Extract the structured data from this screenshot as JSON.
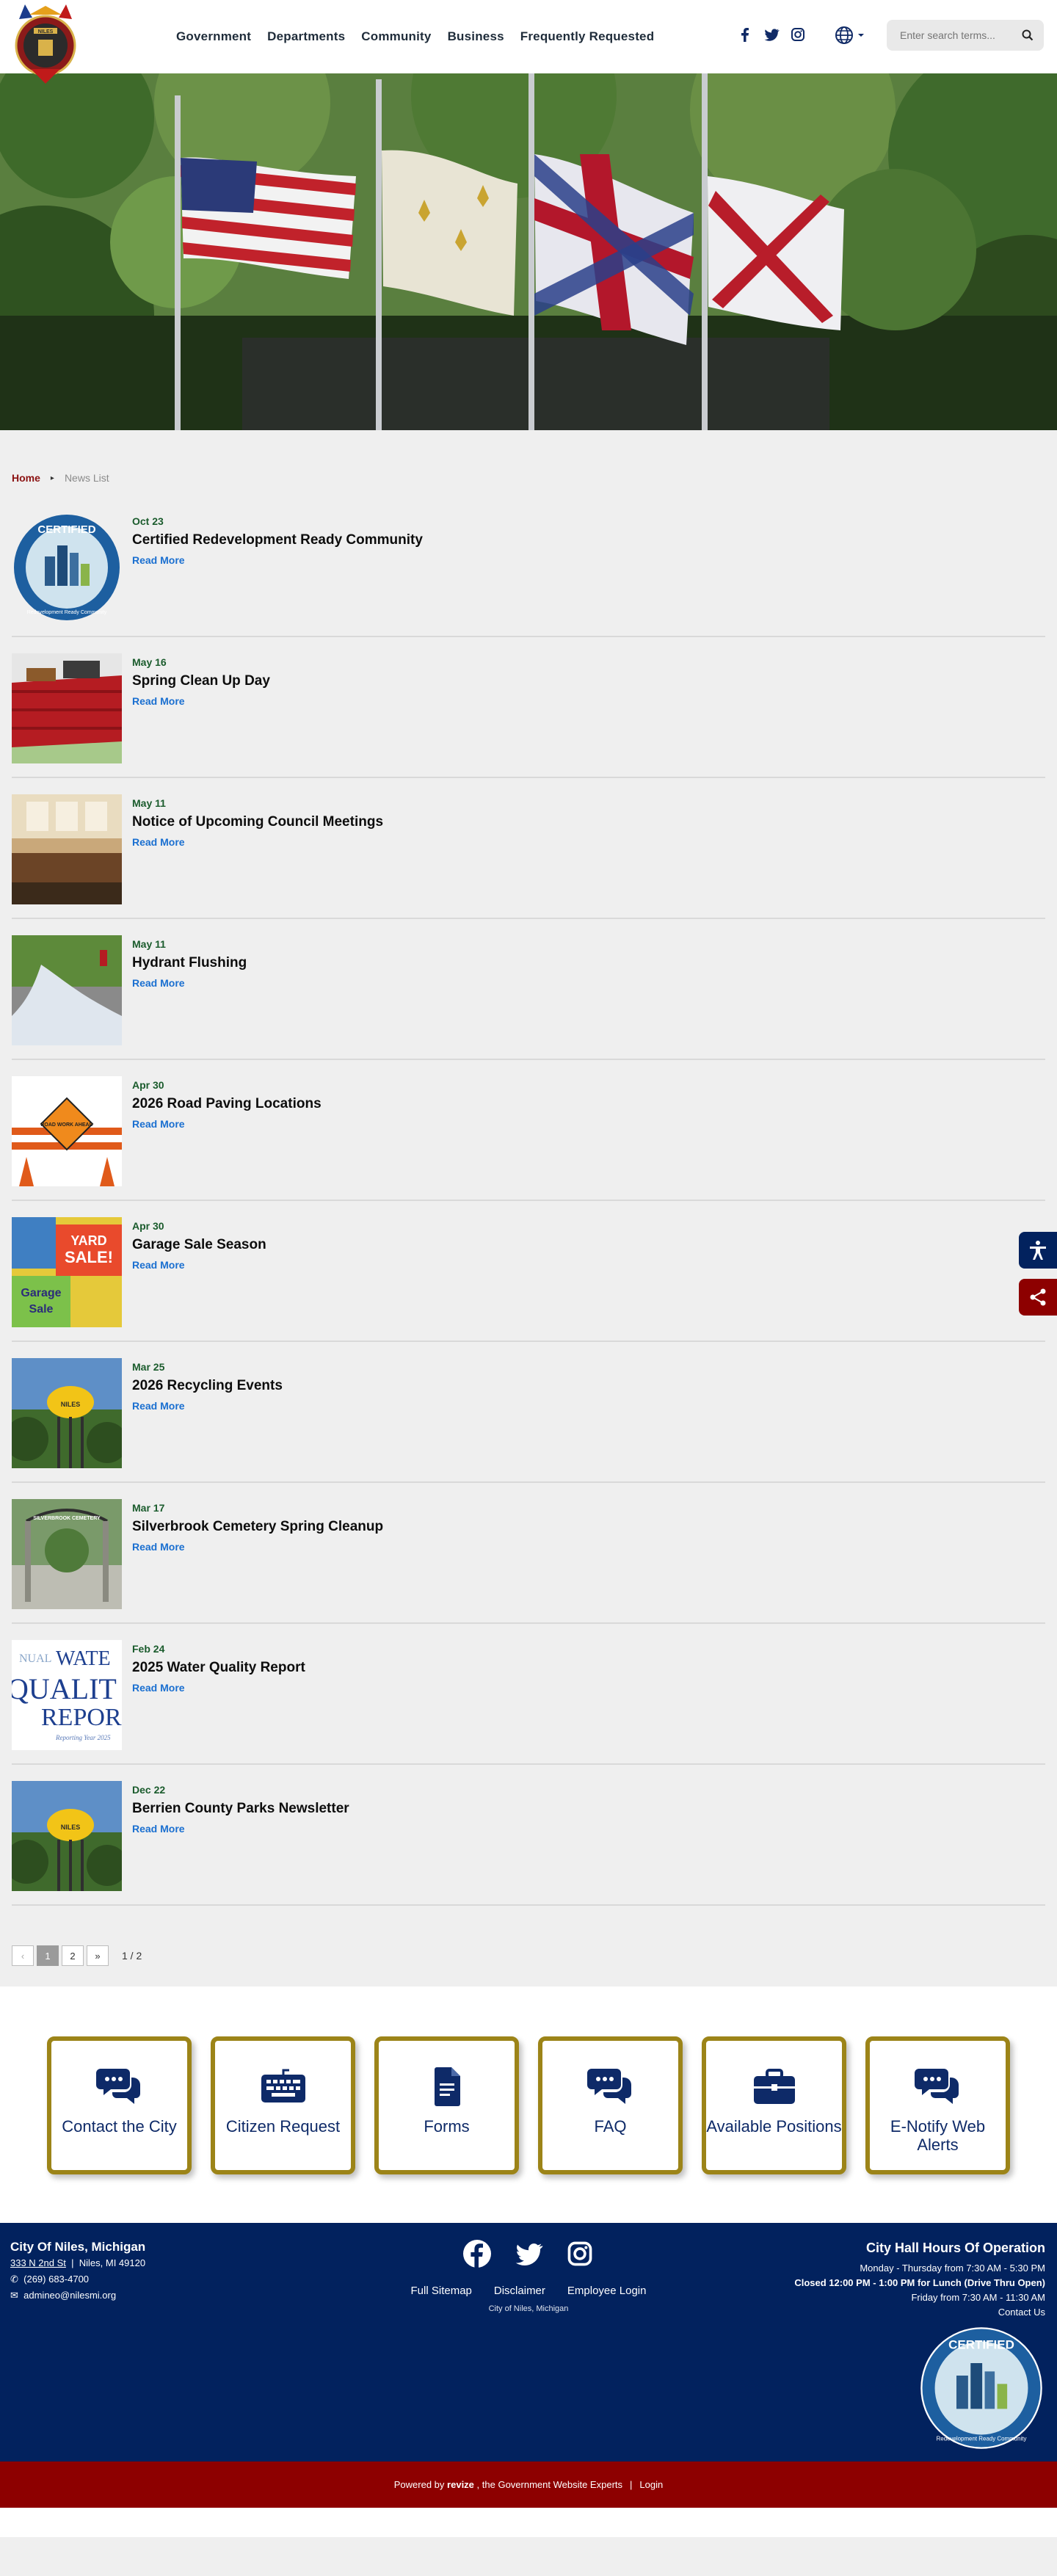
{
  "nav": [
    "Government",
    "Departments",
    "Community",
    "Business",
    "Frequently Requested"
  ],
  "search": {
    "placeholder": "Enter search terms..."
  },
  "breadcrumb": {
    "home": "Home",
    "current": "News List"
  },
  "news": [
    {
      "date": "Oct 23",
      "title": "Certified Redevelopment Ready Community",
      "more": "Read More",
      "thumb": "crc-seal"
    },
    {
      "date": "May 16",
      "title": "Spring Clean Up Day",
      "more": "Read More",
      "thumb": "dumpster"
    },
    {
      "date": "May 11",
      "title": "Notice of Upcoming Council Meetings",
      "more": "Read More",
      "thumb": "council-room"
    },
    {
      "date": "May 11",
      "title": "Hydrant Flushing",
      "more": "Read More",
      "thumb": "hydrant"
    },
    {
      "date": "Apr 30",
      "title": "2026 Road Paving Locations",
      "more": "Read More",
      "thumb": "road-work"
    },
    {
      "date": "Apr 30",
      "title": "Garage Sale Season",
      "more": "Read More",
      "thumb": "garage-sale"
    },
    {
      "date": "Mar 25",
      "title": "2026 Recycling Events",
      "more": "Read More",
      "thumb": "water-tower"
    },
    {
      "date": "Mar 17",
      "title": "Silverbrook Cemetery Spring Cleanup",
      "more": "Read More",
      "thumb": "cemetery-gate"
    },
    {
      "date": "Feb 24",
      "title": "2025 Water Quality Report",
      "more": "Read More",
      "thumb": "water-quality"
    },
    {
      "date": "Dec 22",
      "title": "Berrien County Parks Newsletter",
      "more": "Read More",
      "thumb": "water-tower"
    }
  ],
  "thumb_text": {
    "seal_top": "CERTIFIED",
    "seal_bottom": "Redevelopment Ready Community",
    "road_sign": "ROAD WORK AHEAD",
    "sale_1": "YARD",
    "sale_2": "SALE!",
    "sale_3": "Garage",
    "sale_4": "Sale",
    "tower": "NILES",
    "cemetery": "SILVERBROOK CEMETERY",
    "wq_1": "NUAL",
    "wq_2": "WATE",
    "wq_3": "QUALIT",
    "wq_4": "REPOR",
    "wq_5": "Reporting Year 2025",
    "logo": "NILES"
  },
  "pager": {
    "prev": "‹",
    "pages": [
      "1",
      "2"
    ],
    "next": "»",
    "count": "1 / 2"
  },
  "quick_links": [
    {
      "label": "Contact the City",
      "icon": "chat-bubbles-icon"
    },
    {
      "label": "Citizen Request",
      "icon": "keyboard-icon"
    },
    {
      "label": "Forms",
      "icon": "document-icon"
    },
    {
      "label": "FAQ",
      "icon": "chat-bubbles-icon"
    },
    {
      "label": "Available Positions",
      "icon": "briefcase-icon"
    },
    {
      "label": "E-Notify Web Alerts",
      "icon": "chat-bubbles-icon"
    }
  ],
  "footer": {
    "city": "City Of Niles, Michigan",
    "street": "333 N 2nd St",
    "citystate": "Niles, MI 49120",
    "phone": "(269) 683-4700",
    "email": "admineo@nilesmi.org",
    "links": [
      "Full Sitemap",
      "Disclaimer",
      "Employee Login"
    ],
    "small": "City of Niles, Michigan",
    "hours_title": "City Hall Hours Of Operation",
    "hours_1": "Monday - Thursday from 7:30 AM - 5:30 PM",
    "hours_2": "Closed 12:00 PM - 1:00 PM for Lunch (Drive Thru Open)",
    "hours_3": "Friday from 7:30 AM - 11:30 AM",
    "contact": "Contact Us"
  },
  "bottom_bar": {
    "powered": "Powered by",
    "brand": "revize",
    "tail": ", the Government Website Experts",
    "login": "Login"
  },
  "colors": {
    "brand_red": "#8d0000",
    "footer_navy": "#02225e",
    "quick_gold": "#9c8418",
    "link_blue": "#1a6fd0",
    "date_green": "#1a5b2c"
  }
}
